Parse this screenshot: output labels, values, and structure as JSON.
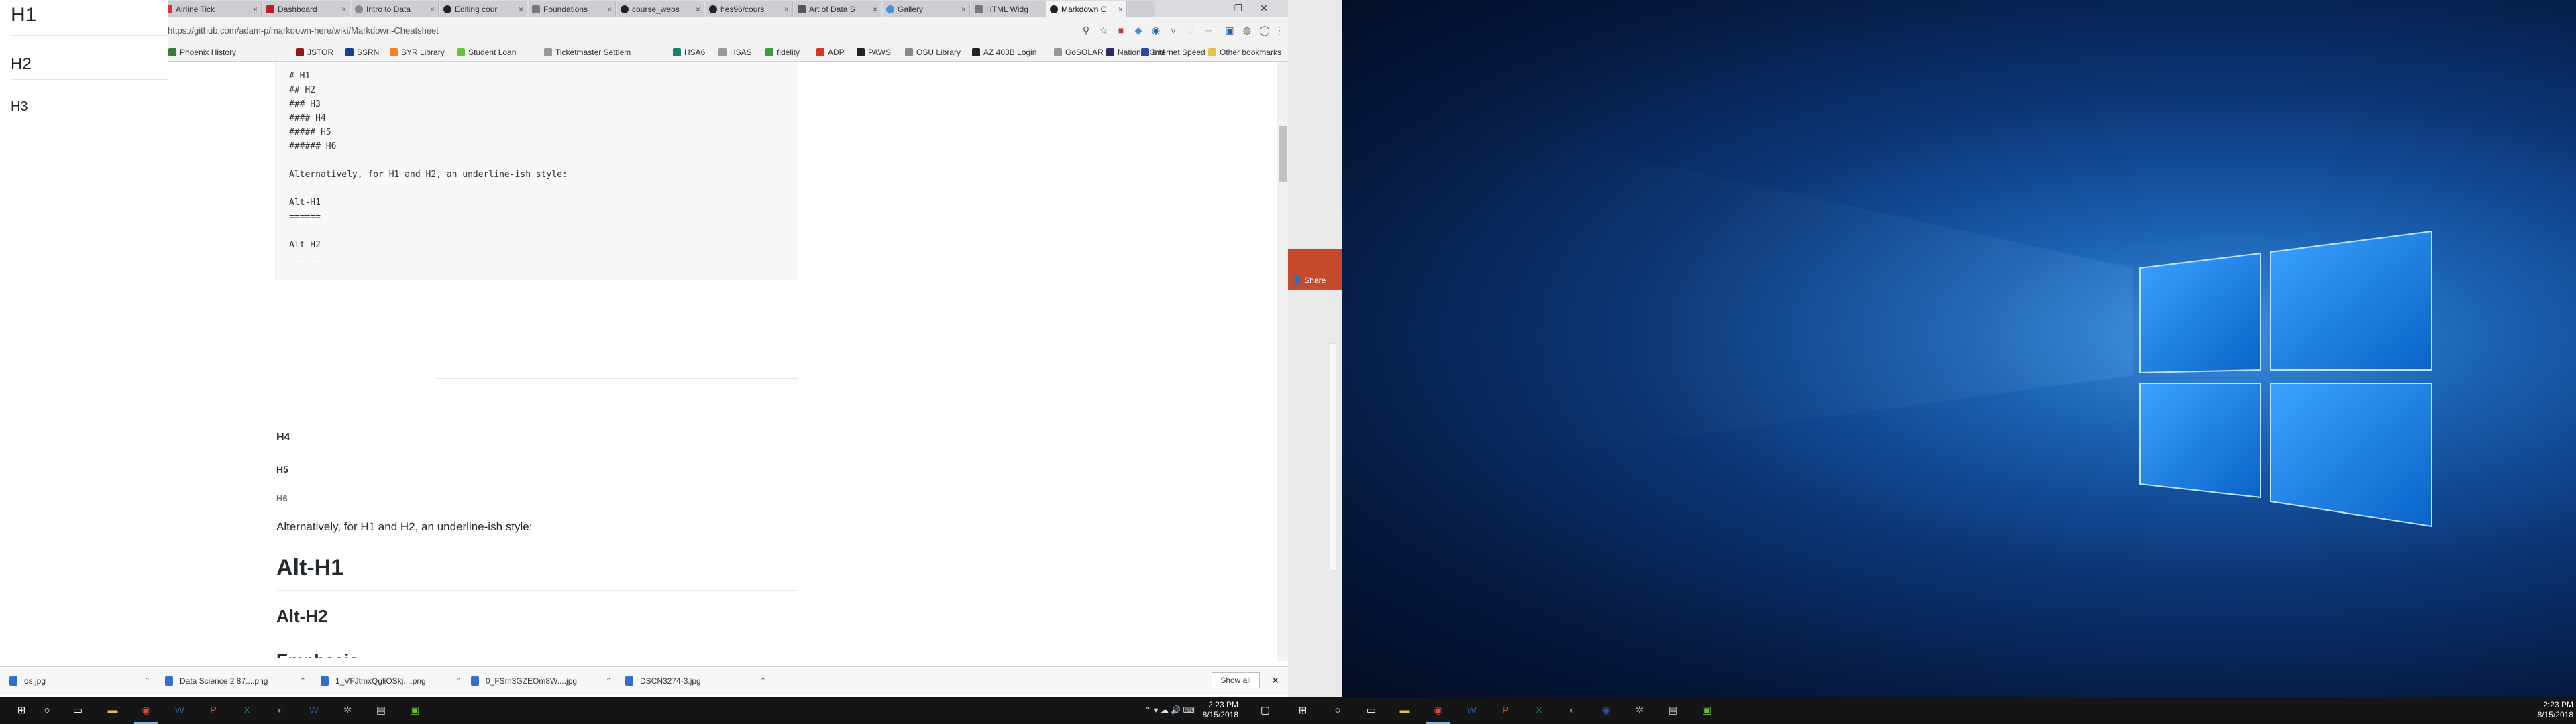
{
  "browser": {
    "tabs": [
      {
        "label": "Airline Tick",
        "icon_color": "#d33"
      },
      {
        "label": "Dashboard",
        "icon_color": "#b22"
      },
      {
        "label": "Intro to Data",
        "icon_color": "#888"
      },
      {
        "label": "Editing cour",
        "icon_color": "#222"
      },
      {
        "label": "Foundations",
        "icon_color": "#777"
      },
      {
        "label": "course_webs",
        "icon_color": "#222"
      },
      {
        "label": "hes96/cours",
        "icon_color": "#222"
      },
      {
        "label": "Art of Data S",
        "icon_color": "#555"
      },
      {
        "label": "Gallery",
        "icon_color": "#4a8fd8"
      },
      {
        "label": "HTML Widg",
        "icon_color": "#777"
      },
      {
        "label": "Markdown C",
        "icon_color": "#222"
      }
    ],
    "url": "https://github.com/adam-p/markdown-here/wiki/Markdown-Cheatsheet",
    "bookmarks": [
      {
        "label": "Phoenix History",
        "icon_color": "#3a7d3a"
      },
      {
        "label": "JSTOR",
        "icon_color": "#8b1a1a"
      },
      {
        "label": "SSRN",
        "icon_color": "#1b3f8c"
      },
      {
        "label": "SYR Library",
        "icon_color": "#f58025"
      },
      {
        "label": "Student Loan",
        "icon_color": "#6bbf3a"
      },
      {
        "label": "Ticketmaster Settlem",
        "icon_color": "#999"
      },
      {
        "label": "HSA6",
        "icon_color": "#1a7f6e"
      },
      {
        "label": "HSAS",
        "icon_color": "#999"
      },
      {
        "label": "fidelity",
        "icon_color": "#3a9c3a"
      },
      {
        "label": "ADP",
        "icon_color": "#d32"
      },
      {
        "label": "PAWS",
        "icon_color": "#222"
      },
      {
        "label": "OSU Library",
        "icon_color": "#888"
      },
      {
        "label": "AZ 403B Login",
        "icon_color": "#222"
      },
      {
        "label": "GoSOLAR",
        "icon_color": "#999"
      },
      {
        "label": "National Grid",
        "icon_color": "#2a2a6a"
      },
      {
        "label": "Internet Speed Test",
        "icon_color": "#2a4aa0"
      },
      {
        "label": "»",
        "icon_color": "transparent"
      },
      {
        "label": "Other bookmarks",
        "icon_color": "#e6c14a"
      }
    ]
  },
  "sidenav": {
    "h1": "H1",
    "h2": "H2",
    "h3": "H3"
  },
  "code_block": "# H1\n## H2\n### H3\n#### H4\n##### H5\n###### H6\n\nAlternatively, for H1 and H2, an underline-ish style:\n\nAlt-H1\n======\n\nAlt-H2\n------",
  "rendered": {
    "h4": "H4",
    "h5": "H5",
    "h6": "H6",
    "paragraph": "Alternatively, for H1 and H2, an underline-ish style:",
    "alt_h1": "Alt-H1",
    "alt_h2": "Alt-H2",
    "next_heading": "Emphasis"
  },
  "downloads": {
    "items": [
      {
        "label": "ds.jpg"
      },
      {
        "label": "Data Science 2 87....png"
      },
      {
        "label": "1_VFJtmxQgliOSkj....png"
      },
      {
        "label": "0_FSm3GZEOm8W....jpg"
      },
      {
        "label": "DSCN3274-3.jpg"
      }
    ],
    "show_all": "Show all"
  },
  "word_panel": {
    "share": "Share"
  },
  "taskbar": {
    "clock_time_left": "2:23 PM",
    "clock_date_left": "8/15/2018",
    "clock_time_right": "2:23 PM",
    "clock_date_right": "8/15/2018"
  }
}
